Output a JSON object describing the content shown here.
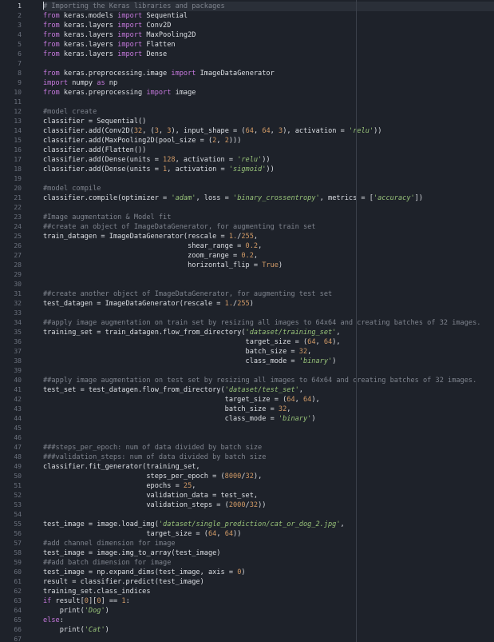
{
  "editor": {
    "active_line": 1,
    "lines": [
      [
        [
          "cm",
          "# Importing the Keras libraries and packages"
        ]
      ],
      [
        [
          "kw",
          "from"
        ],
        [
          "pl",
          " keras.models "
        ],
        [
          "kw",
          "import"
        ],
        [
          "pl",
          " Sequential"
        ]
      ],
      [
        [
          "kw",
          "from"
        ],
        [
          "pl",
          " keras.layers "
        ],
        [
          "kw",
          "import"
        ],
        [
          "pl",
          " Conv2D"
        ]
      ],
      [
        [
          "kw",
          "from"
        ],
        [
          "pl",
          " keras.layers "
        ],
        [
          "kw",
          "import"
        ],
        [
          "pl",
          " MaxPooling2D"
        ]
      ],
      [
        [
          "kw",
          "from"
        ],
        [
          "pl",
          " keras.layers "
        ],
        [
          "kw",
          "import"
        ],
        [
          "pl",
          " Flatten"
        ]
      ],
      [
        [
          "kw",
          "from"
        ],
        [
          "pl",
          " keras.layers "
        ],
        [
          "kw",
          "import"
        ],
        [
          "pl",
          " Dense"
        ]
      ],
      [],
      [
        [
          "kw",
          "from"
        ],
        [
          "pl",
          " keras.preprocessing.image "
        ],
        [
          "kw",
          "import"
        ],
        [
          "pl",
          " ImageDataGenerator"
        ]
      ],
      [
        [
          "kw",
          "import"
        ],
        [
          "pl",
          " numpy "
        ],
        [
          "kw",
          "as"
        ],
        [
          "pl",
          " np"
        ]
      ],
      [
        [
          "kw",
          "from"
        ],
        [
          "pl",
          " keras.preprocessing "
        ],
        [
          "kw",
          "import"
        ],
        [
          "pl",
          " image"
        ]
      ],
      [],
      [
        [
          "cm",
          "#model create"
        ]
      ],
      [
        [
          "pl",
          "classifier = Sequential()"
        ]
      ],
      [
        [
          "pl",
          "classifier.add(Conv2D("
        ],
        [
          "num",
          "32"
        ],
        [
          "pl",
          ", ("
        ],
        [
          "num",
          "3"
        ],
        [
          "pl",
          ", "
        ],
        [
          "num",
          "3"
        ],
        [
          "pl",
          "), input_shape = ("
        ],
        [
          "num",
          "64"
        ],
        [
          "pl",
          ", "
        ],
        [
          "num",
          "64"
        ],
        [
          "pl",
          ", "
        ],
        [
          "num",
          "3"
        ],
        [
          "pl",
          "), activation = "
        ],
        [
          "str",
          "'relu'"
        ],
        [
          "pl",
          "))"
        ]
      ],
      [
        [
          "pl",
          "classifier.add(MaxPooling2D(pool_size = ("
        ],
        [
          "num",
          "2"
        ],
        [
          "pl",
          ", "
        ],
        [
          "num",
          "2"
        ],
        [
          "pl",
          ")))"
        ]
      ],
      [
        [
          "pl",
          "classifier.add(Flatten())"
        ]
      ],
      [
        [
          "pl",
          "classifier.add(Dense(units = "
        ],
        [
          "num",
          "128"
        ],
        [
          "pl",
          ", activation = "
        ],
        [
          "str",
          "'relu'"
        ],
        [
          "pl",
          "))"
        ]
      ],
      [
        [
          "pl",
          "classifier.add(Dense(units = "
        ],
        [
          "num",
          "1"
        ],
        [
          "pl",
          ", activation = "
        ],
        [
          "str",
          "'sigmoid'"
        ],
        [
          "pl",
          "))"
        ]
      ],
      [],
      [
        [
          "cm",
          "#model compile"
        ]
      ],
      [
        [
          "pl",
          "classifier.compile(optimizer = "
        ],
        [
          "str",
          "'adam'"
        ],
        [
          "pl",
          ", loss = "
        ],
        [
          "str",
          "'binary_crossentropy'"
        ],
        [
          "pl",
          ", metrics = ["
        ],
        [
          "str",
          "'accuracy'"
        ],
        [
          "pl",
          "])"
        ]
      ],
      [],
      [
        [
          "cm",
          "#Image augmentation & Model fit"
        ]
      ],
      [
        [
          "cm",
          "##create an object of ImageDataGenerator, for augmenting train set"
        ]
      ],
      [
        [
          "pl",
          "train_datagen = ImageDataGenerator(rescale = "
        ],
        [
          "num",
          "1."
        ],
        [
          "pl",
          "/"
        ],
        [
          "num",
          "255"
        ],
        [
          "pl",
          ","
        ]
      ],
      [
        [
          "pl",
          "                                   shear_range = "
        ],
        [
          "num",
          "0.2"
        ],
        [
          "pl",
          ","
        ]
      ],
      [
        [
          "pl",
          "                                   zoom_range = "
        ],
        [
          "num",
          "0.2"
        ],
        [
          "pl",
          ","
        ]
      ],
      [
        [
          "pl",
          "                                   horizontal_flip = "
        ],
        [
          "num",
          "True"
        ],
        [
          "pl",
          ")"
        ]
      ],
      [],
      [],
      [
        [
          "cm",
          "##create another object of ImageDataGenerator, for augmenting test set"
        ]
      ],
      [
        [
          "pl",
          "test_datagen = ImageDataGenerator(rescale = "
        ],
        [
          "num",
          "1."
        ],
        [
          "pl",
          "/"
        ],
        [
          "num",
          "255"
        ],
        [
          "pl",
          ")"
        ]
      ],
      [],
      [
        [
          "cm",
          "##apply image augmentation on train set by resizing all images to 64x64 and creating batches of 32 images."
        ]
      ],
      [
        [
          "pl",
          "training_set = train_datagen.flow_from_directory("
        ],
        [
          "str",
          "'dataset/training_set'"
        ],
        [
          "pl",
          ","
        ]
      ],
      [
        [
          "pl",
          "                                                 target_size = ("
        ],
        [
          "num",
          "64"
        ],
        [
          "pl",
          ", "
        ],
        [
          "num",
          "64"
        ],
        [
          "pl",
          "),"
        ]
      ],
      [
        [
          "pl",
          "                                                 batch_size = "
        ],
        [
          "num",
          "32"
        ],
        [
          "pl",
          ","
        ]
      ],
      [
        [
          "pl",
          "                                                 class_mode = "
        ],
        [
          "str",
          "'binary'"
        ],
        [
          "pl",
          ")"
        ]
      ],
      [],
      [
        [
          "cm",
          "##apply image augmentation on test set by resizing all images to 64x64 and creating batches of 32 images."
        ]
      ],
      [
        [
          "pl",
          "test_set = test_datagen.flow_from_directory("
        ],
        [
          "str",
          "'dataset/test_set'"
        ],
        [
          "pl",
          ","
        ]
      ],
      [
        [
          "pl",
          "                                            target_size = ("
        ],
        [
          "num",
          "64"
        ],
        [
          "pl",
          ", "
        ],
        [
          "num",
          "64"
        ],
        [
          "pl",
          "),"
        ]
      ],
      [
        [
          "pl",
          "                                            batch_size = "
        ],
        [
          "num",
          "32"
        ],
        [
          "pl",
          ","
        ]
      ],
      [
        [
          "pl",
          "                                            class_mode = "
        ],
        [
          "str",
          "'binary'"
        ],
        [
          "pl",
          ")"
        ]
      ],
      [],
      [],
      [
        [
          "cm",
          "###steps_per_epoch: num of data divided by batch size"
        ]
      ],
      [
        [
          "cm",
          "###validation_steps: num of data divided by batch size"
        ]
      ],
      [
        [
          "pl",
          "classifier.fit_generator(training_set,"
        ]
      ],
      [
        [
          "pl",
          "                         steps_per_epoch = ("
        ],
        [
          "num",
          "8000"
        ],
        [
          "pl",
          "/"
        ],
        [
          "num",
          "32"
        ],
        [
          "pl",
          "),"
        ]
      ],
      [
        [
          "pl",
          "                         epochs = "
        ],
        [
          "num",
          "25"
        ],
        [
          "pl",
          ","
        ]
      ],
      [
        [
          "pl",
          "                         validation_data = test_set,"
        ]
      ],
      [
        [
          "pl",
          "                         validation_steps = ("
        ],
        [
          "num",
          "2000"
        ],
        [
          "pl",
          "/"
        ],
        [
          "num",
          "32"
        ],
        [
          "pl",
          "))"
        ]
      ],
      [],
      [
        [
          "pl",
          "test_image = image.load_img("
        ],
        [
          "str",
          "'dataset/single_prediction/cat_or_dog_2.jpg'"
        ],
        [
          "pl",
          ","
        ]
      ],
      [
        [
          "pl",
          "                         target_size = ("
        ],
        [
          "num",
          "64"
        ],
        [
          "pl",
          ", "
        ],
        [
          "num",
          "64"
        ],
        [
          "pl",
          "))"
        ]
      ],
      [
        [
          "cm",
          "#add channel dimension for image"
        ]
      ],
      [
        [
          "pl",
          "test_image = image.img_to_array(test_image)"
        ]
      ],
      [
        [
          "cm",
          "##add batch dimension for image"
        ]
      ],
      [
        [
          "pl",
          "test_image = np.expand_dims(test_image, axis = "
        ],
        [
          "num",
          "0"
        ],
        [
          "pl",
          ")"
        ]
      ],
      [
        [
          "pl",
          "result = classifier.predict(test_image)"
        ]
      ],
      [
        [
          "pl",
          "training_set.class_indices"
        ]
      ],
      [
        [
          "kw",
          "if"
        ],
        [
          "pl",
          " result["
        ],
        [
          "num",
          "0"
        ],
        [
          "pl",
          "]["
        ],
        [
          "num",
          "0"
        ],
        [
          "pl",
          "] == "
        ],
        [
          "num",
          "1"
        ],
        [
          "pl",
          ":"
        ]
      ],
      [
        [
          "pl",
          "    print("
        ],
        [
          "str",
          "'Dog'"
        ],
        [
          "pl",
          ")"
        ]
      ],
      [
        [
          "kw",
          "else"
        ],
        [
          "pl",
          ":"
        ]
      ],
      [
        [
          "pl",
          "    print("
        ],
        [
          "str",
          "'Cat'"
        ],
        [
          "pl",
          ")"
        ]
      ],
      []
    ]
  }
}
